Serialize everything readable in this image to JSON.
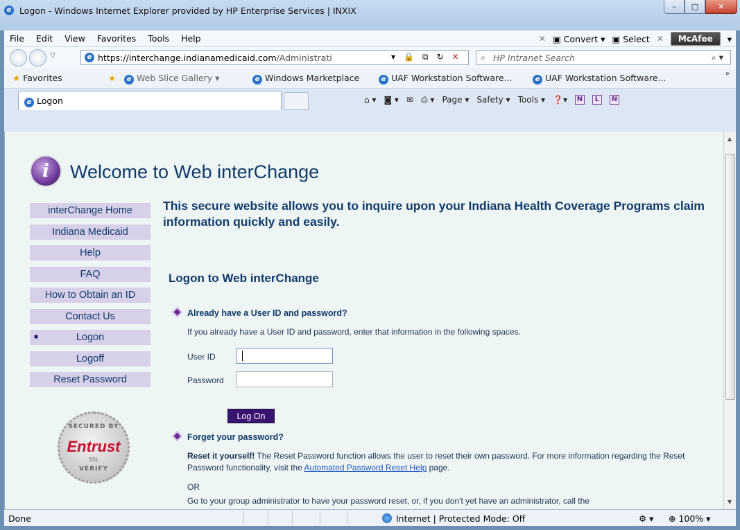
{
  "window": {
    "title": "Logon - Windows Internet Explorer provided by HP Enterprise Services | INXIX",
    "min": "–",
    "max": "□",
    "close": "✕"
  },
  "menu": [
    "File",
    "Edit",
    "View",
    "Favorites",
    "Tools",
    "Help"
  ],
  "toolbar_right": {
    "convert": "Convert",
    "select": "Select",
    "mcafee": "McAfee"
  },
  "address": {
    "url_prefix": "https://",
    "url_domain": "interchange.indianamedicaid.com",
    "url_rest": "/Administrati"
  },
  "search": {
    "placeholder": "HP Intranet Search"
  },
  "favorites": {
    "label": "Favorites",
    "items": [
      "Web Slice Gallery ▾",
      "Windows Marketplace",
      "UAF Workstation Software...",
      "UAF Workstation Software..."
    ]
  },
  "tab": {
    "title": "Logon"
  },
  "commandbar": {
    "page": "Page ▾",
    "safety": "Safety ▾",
    "tools": "Tools ▾"
  },
  "page": {
    "title": "Welcome to Web interChange",
    "intro": "This secure website allows you to inquire upon your Indiana Health Coverage Programs claim information quickly and easily.",
    "logon_heading": "Logon to Web interChange",
    "nav": [
      "interChange Home",
      "Indiana Medicaid",
      "Help",
      "FAQ",
      "How to Obtain an ID",
      "Contact Us",
      "Logon",
      "Logoff",
      "Reset Password"
    ],
    "active_nav_marker": "■",
    "q1": "Already have a User ID and password?",
    "p1": "If you already have a User ID and password, enter that information in the following spaces.",
    "userid_label": "User ID",
    "password_label": "Password",
    "userid_value": "",
    "password_value": "",
    "logon_button": "Log On",
    "q2": "Forget your password?",
    "p2_bold": "Reset it yourself!",
    "p2_text": " The Reset Password function allows the user to reset their own password. For more information regarding the Reset Password functionality, visit the ",
    "p2_link": "Automated Password Reset Help",
    "p2_tail": " page.",
    "or": "OR",
    "p3": "Go to your group administrator to have your password reset, or, if you don't yet have an administrator, call the"
  },
  "seal": {
    "top": "SECURED BY",
    "brand": "Entrust",
    "ssl": "SSL",
    "bottom": "VERIFY"
  },
  "status": {
    "left": "Done",
    "zone": "Internet | Protected Mode: Off",
    "zoom": "100%"
  }
}
